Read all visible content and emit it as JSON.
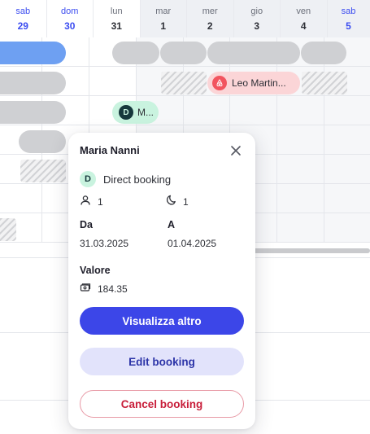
{
  "calendar": {
    "days": [
      {
        "weekday": "sab",
        "date": "29"
      },
      {
        "weekday": "dom",
        "date": "30"
      },
      {
        "weekday": "lun",
        "date": "31"
      },
      {
        "weekday": "mar",
        "date": "1"
      },
      {
        "weekday": "mer",
        "date": "2"
      },
      {
        "weekday": "gio",
        "date": "3"
      },
      {
        "weekday": "ven",
        "date": "4"
      },
      {
        "weekday": "sab",
        "date": "5"
      }
    ],
    "bookings": {
      "airbnb_label": "Leo Martin...",
      "direct_initial": "D",
      "direct_label": "M..."
    }
  },
  "popup": {
    "guest_name": "Maria Nanni",
    "source": {
      "initial": "D",
      "label": "Direct booking"
    },
    "guests": "1",
    "nights": "1",
    "from_label": "Da",
    "from_value": "31.03.2025",
    "to_label": "A",
    "to_value": "01.04.2025",
    "value_label": "Valore",
    "value_amount": "184.35",
    "buttons": {
      "more": "Visualizza altro",
      "edit": "Edit booking",
      "cancel": "Cancel booking"
    }
  },
  "icons": {
    "close": "close-icon",
    "guests": "person-icon",
    "nights": "moon-icon",
    "payment": "payment-icon",
    "airbnb": "airbnb-icon"
  },
  "colors": {
    "primary": "#3c46e8",
    "weekend_text": "#3c4df0",
    "direct_booking": "#c9f3df",
    "airbnb_booking": "#fbd5d7",
    "danger": "#c81e3a"
  }
}
